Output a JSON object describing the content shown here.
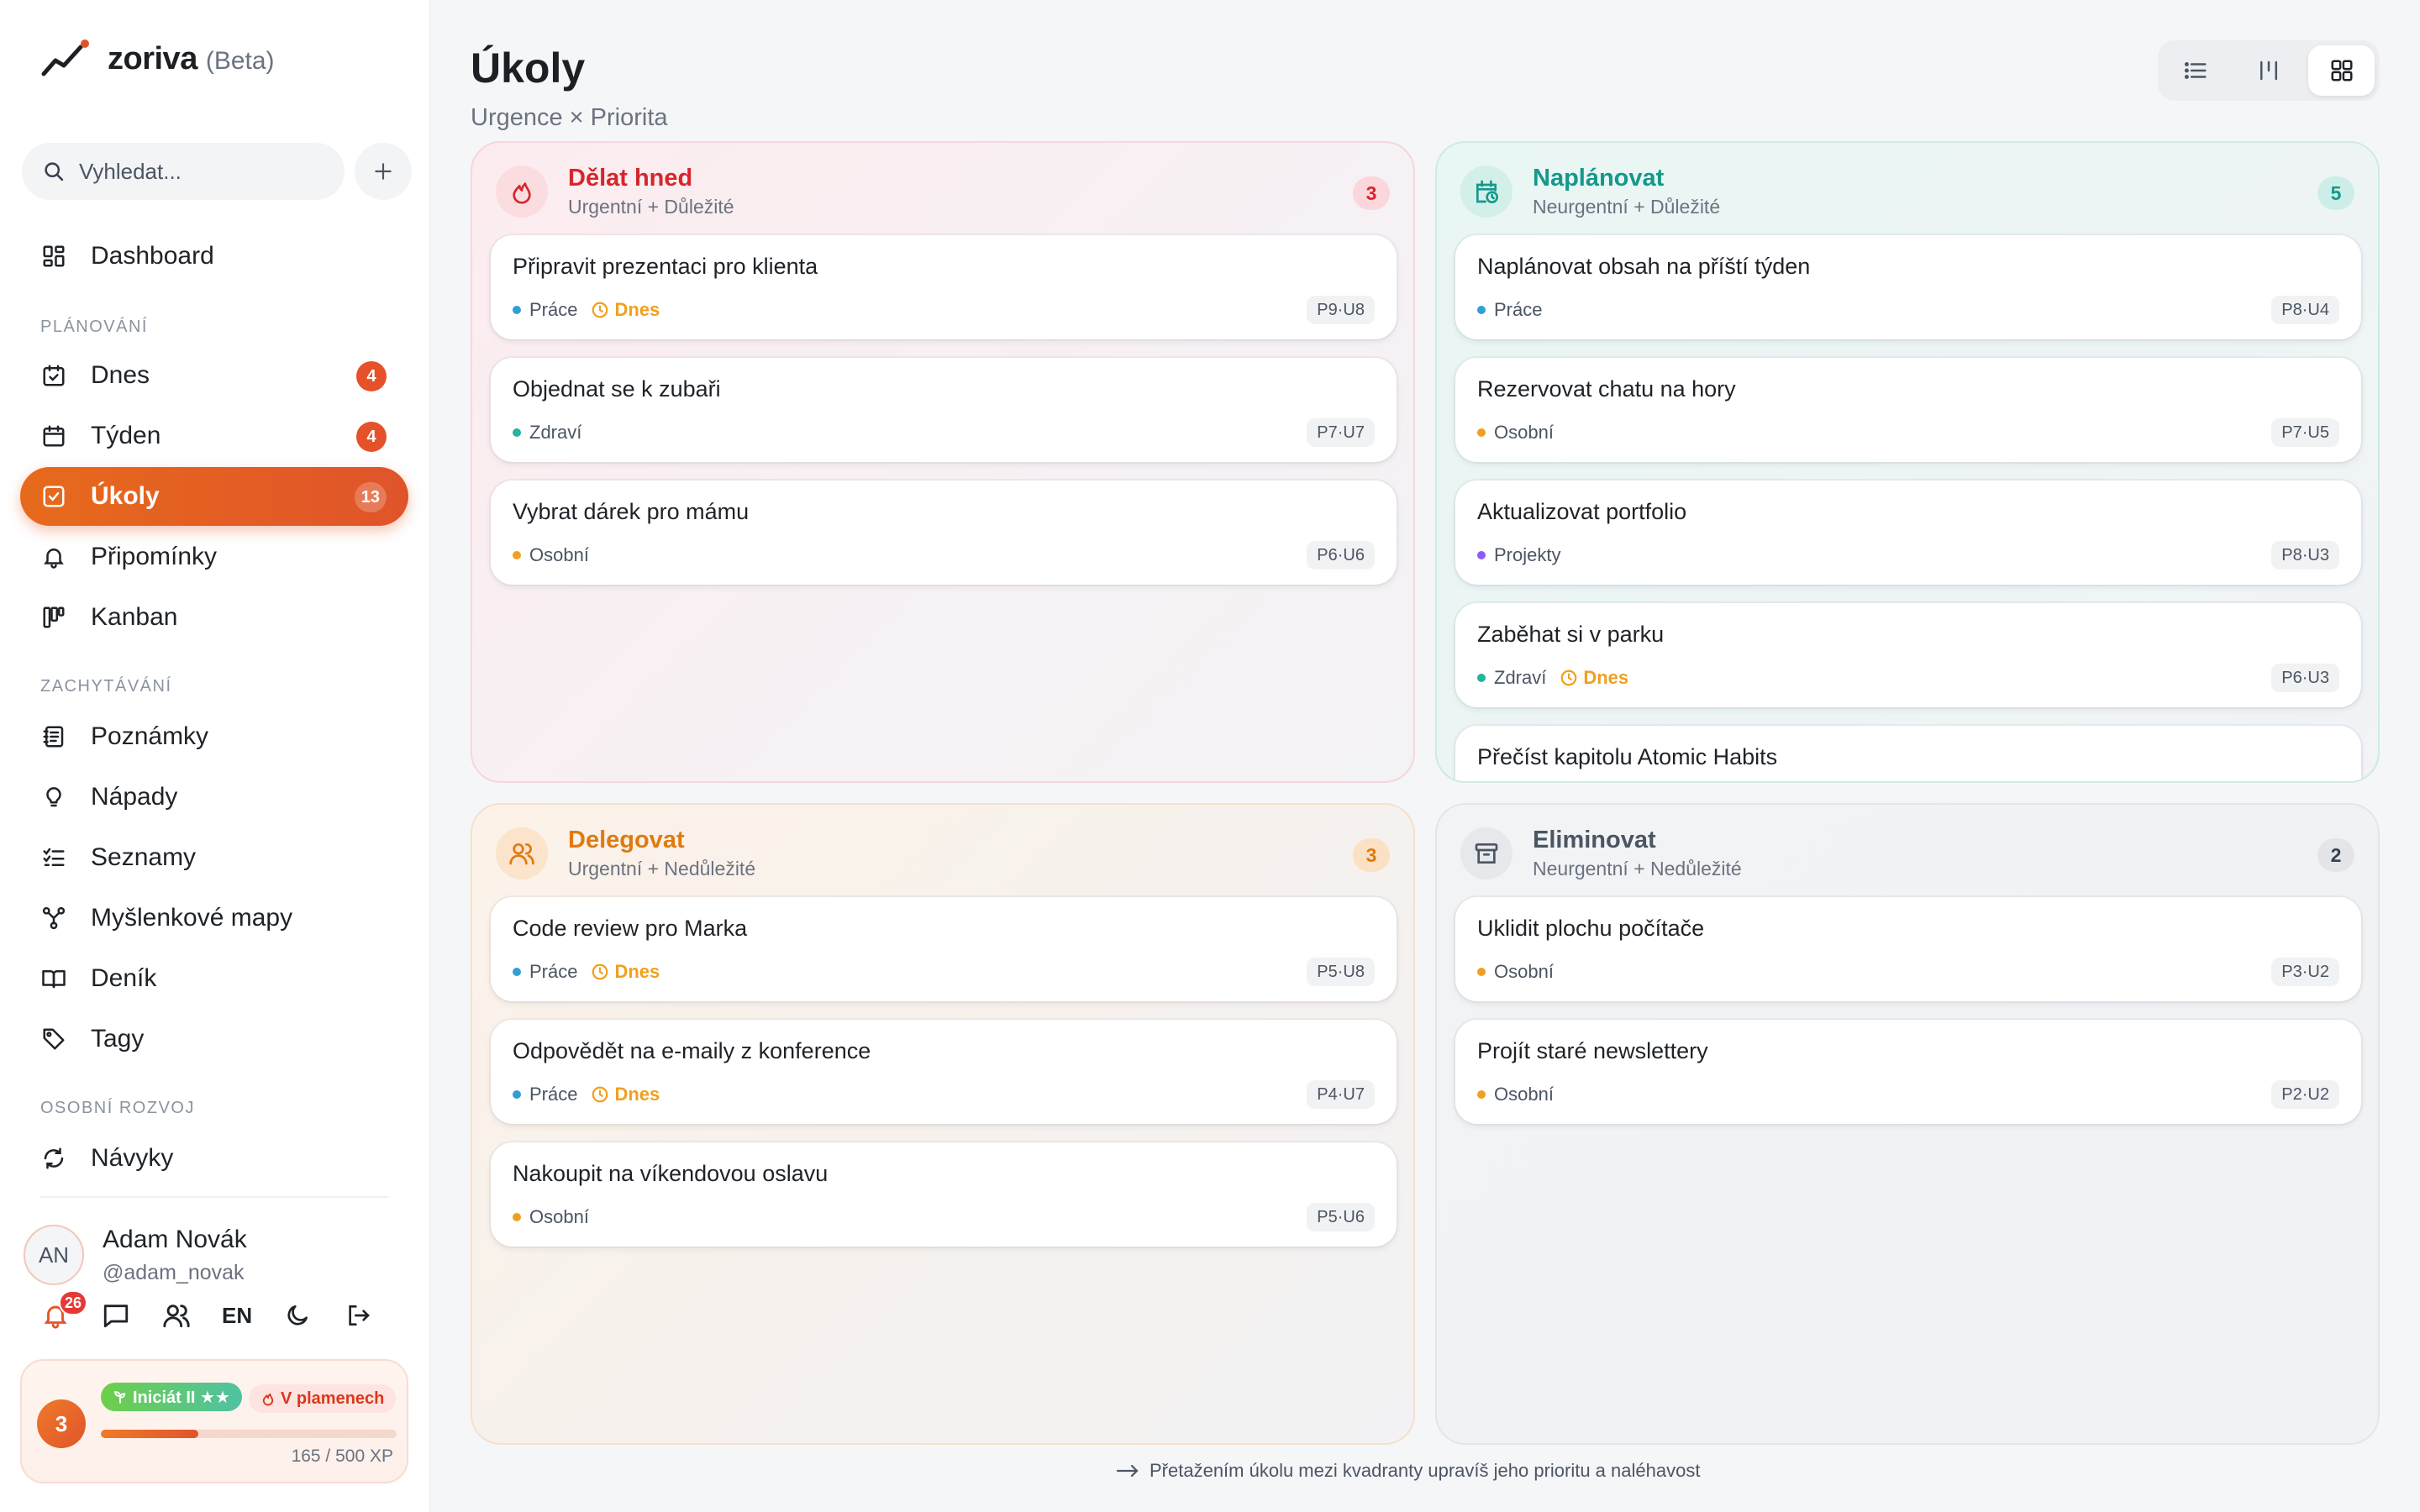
{
  "app": {
    "name": "zoriva",
    "beta": "(Beta)"
  },
  "search": {
    "placeholder": "Vyhledat..."
  },
  "sidebar": {
    "dashboard": "Dashboard",
    "sections": {
      "planning": "PLÁNOVÁNÍ",
      "capture": "ZACHYTÁVÁNÍ",
      "growth": "OSOBNÍ ROZVOJ"
    },
    "items": {
      "today": {
        "label": "Dnes",
        "badge": "4"
      },
      "week": {
        "label": "Týden",
        "badge": "4"
      },
      "tasks": {
        "label": "Úkoly",
        "badge": "13"
      },
      "reminders": {
        "label": "Připomínky"
      },
      "kanban": {
        "label": "Kanban"
      },
      "notes": {
        "label": "Poznámky"
      },
      "ideas": {
        "label": "Nápady"
      },
      "lists": {
        "label": "Seznamy"
      },
      "mindmaps": {
        "label": "Myšlenkové mapy"
      },
      "journal": {
        "label": "Deník"
      },
      "tags": {
        "label": "Tagy"
      },
      "habits": {
        "label": "Návyky"
      }
    }
  },
  "user": {
    "initials": "AN",
    "name": "Adam Novák",
    "handle": "@adam_novak",
    "notifications": "26",
    "lang": "EN"
  },
  "gamification": {
    "level": "3",
    "rank": "Iniciát II ★★",
    "streak": "V plamenech",
    "xp_text": "165 / 500 XP",
    "xp_fraction": 0.33
  },
  "page": {
    "title": "Úkoly",
    "subtitle": "Urgence × Priorita"
  },
  "quadrants": {
    "do": {
      "title": "Dělat hned",
      "subtitle": "Urgentní + Důležité",
      "count": "3",
      "cards": [
        {
          "title": "Připravit prezentaci pro klienta",
          "tag": "Práce",
          "due": "Dnes",
          "code": "P9·U8"
        },
        {
          "title": "Objednat se k zubaři",
          "tag": "Zdraví",
          "code": "P7·U7"
        },
        {
          "title": "Vybrat dárek pro mámu",
          "tag": "Osobní",
          "code": "P6·U6"
        }
      ]
    },
    "plan": {
      "title": "Naplánovat",
      "subtitle": "Neurgentní + Důležité",
      "count": "5",
      "cards": [
        {
          "title": "Naplánovat obsah na příští týden",
          "tag": "Práce",
          "code": "P8·U4"
        },
        {
          "title": "Rezervovat chatu na hory",
          "tag": "Osobní",
          "code": "P7·U5"
        },
        {
          "title": "Aktualizovat portfolio",
          "tag": "Projekty",
          "code": "P8·U3"
        },
        {
          "title": "Zaběhat si v parku",
          "tag": "Zdraví",
          "due": "Dnes",
          "code": "P6·U3"
        },
        {
          "title": "Přečíst kapitolu Atomic Habits"
        }
      ]
    },
    "delegate": {
      "title": "Delegovat",
      "subtitle": "Urgentní + Nedůležité",
      "count": "3",
      "cards": [
        {
          "title": "Code review pro Marka",
          "tag": "Práce",
          "due": "Dnes",
          "code": "P5·U8"
        },
        {
          "title": "Odpovědět na e-maily z konference",
          "tag": "Práce",
          "due": "Dnes",
          "code": "P4·U7"
        },
        {
          "title": "Nakoupit na víkendovou oslavu",
          "tag": "Osobní",
          "code": "P5·U6"
        }
      ]
    },
    "eliminate": {
      "title": "Eliminovat",
      "subtitle": "Neurgentní + Nedůležité",
      "count": "2",
      "cards": [
        {
          "title": "Uklidit plochu počítače",
          "tag": "Osobní",
          "code": "P3·U2"
        },
        {
          "title": "Projít staré newslettery",
          "tag": "Osobní",
          "code": "P2·U2"
        }
      ]
    }
  },
  "colors": {
    "accent": "#e0542a",
    "tag_work": "#2f9fd6",
    "tag_health": "#22b5a0",
    "tag_personal": "#f0a020",
    "tag_projects": "#8b5cf6",
    "do": "#d6262c",
    "plan": "#14998a",
    "delegate": "#e07a10",
    "eliminate": "#4b5563"
  },
  "hint": "Přetažením úkolu mezi kvadranty upravíš jeho prioritu a naléhavost"
}
